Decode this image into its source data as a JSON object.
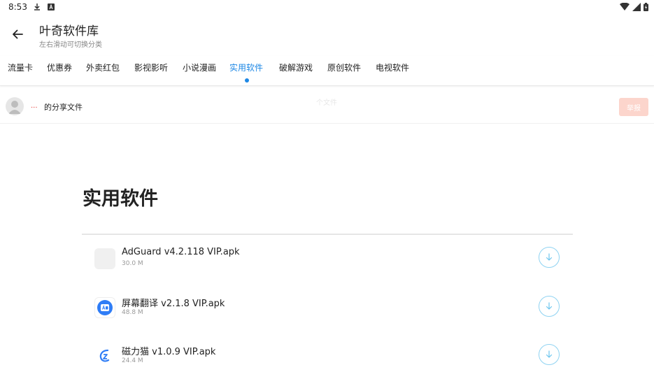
{
  "status": {
    "time": "8:53"
  },
  "header": {
    "title": "叶奇软件库",
    "subtitle": "左右滑动可切换分类"
  },
  "tabs": [
    {
      "label": "流量卡"
    },
    {
      "label": "优惠券"
    },
    {
      "label": "外卖红包"
    },
    {
      "label": "影视影听"
    },
    {
      "label": "小说漫画"
    },
    {
      "label": "实用软件",
      "active": true
    },
    {
      "label": "破解游戏"
    },
    {
      "label": "原创软件"
    },
    {
      "label": "电视软件"
    }
  ],
  "share": {
    "user": "...",
    "text": "的分享文件",
    "faded_label": "个文件",
    "report": "举报"
  },
  "section": {
    "title": "实用软件"
  },
  "files": [
    {
      "name": "AdGuard v4.2.118 VIP.apk",
      "size": "30.0 M",
      "icon": "app-placeholder-icon"
    },
    {
      "name": "屏幕翻译 v2.1.8 VIP.apk",
      "size": "48.8 M",
      "icon": "translate-app-icon"
    },
    {
      "name": "磁力猫 v1.0.9 VIP.apk",
      "size": "24.4 M",
      "icon": "magnet-cat-app-icon"
    }
  ],
  "colors": {
    "accent": "#1e88e5",
    "download_outline": "#8fd3f2",
    "report_bg": "#fcd5cc",
    "user_red": "#e53935"
  }
}
